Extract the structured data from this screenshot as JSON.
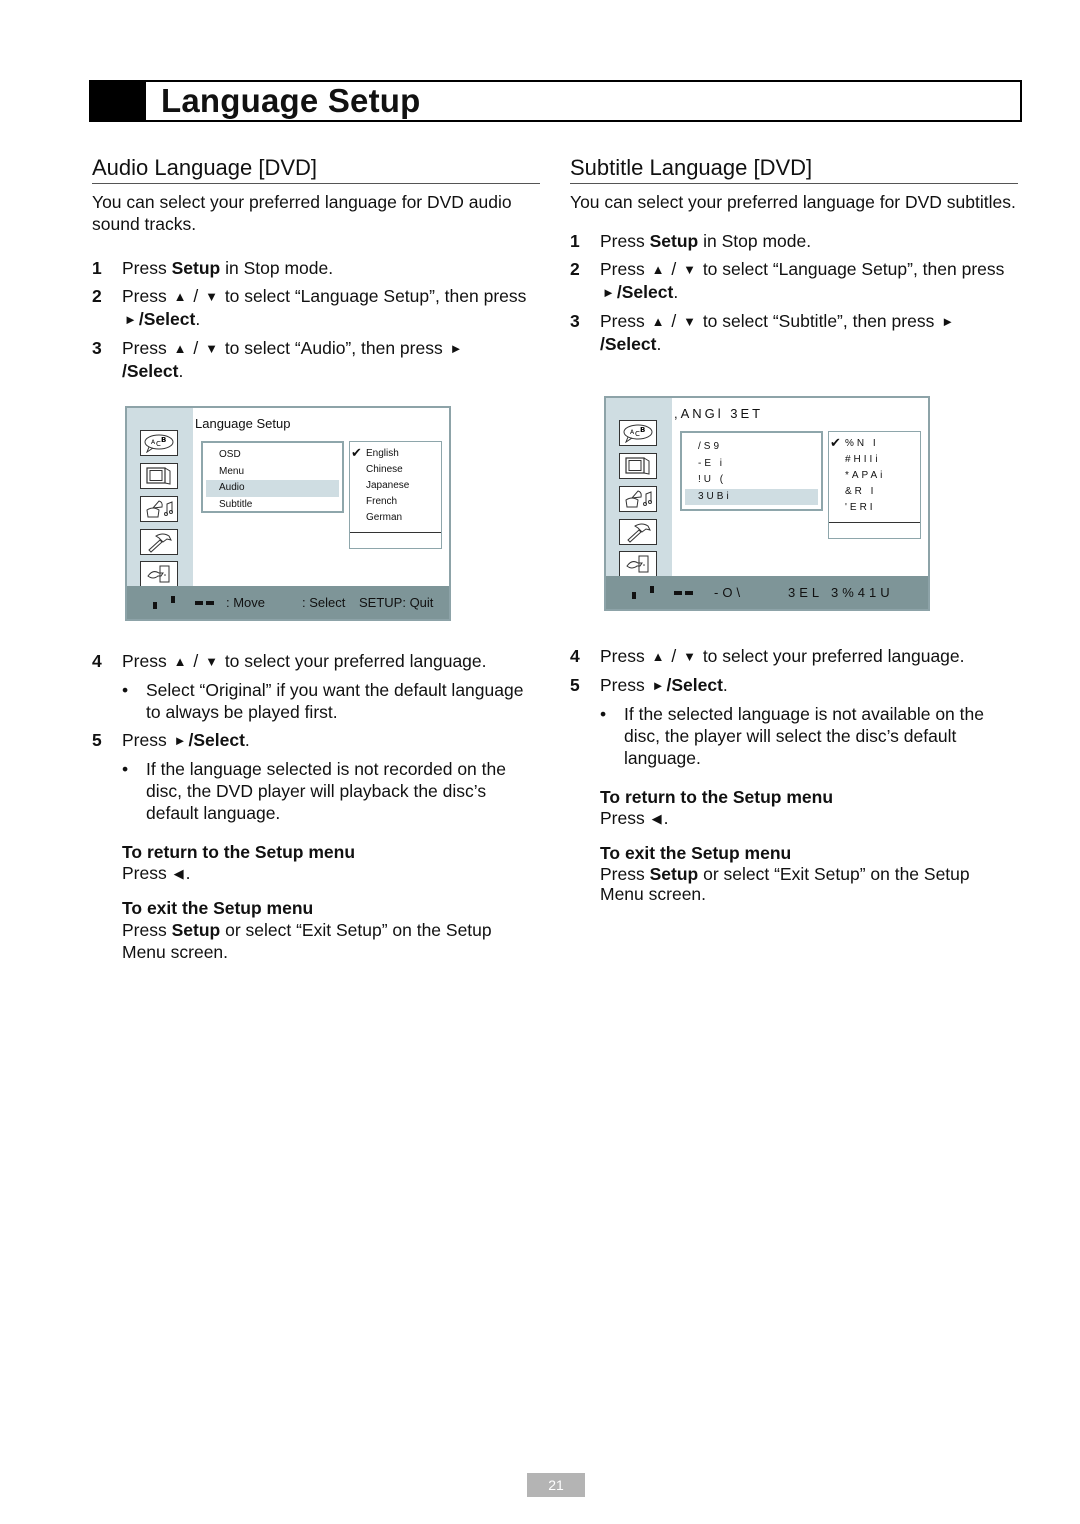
{
  "page": {
    "title": "Language Setup",
    "page_number": "21"
  },
  "audio": {
    "heading": "Audio Language [DVD]",
    "intro": "You can select your preferred language for DVD audio sound tracks.",
    "steps": [
      {
        "num": "1",
        "pre": "Press ",
        "bold": "Setup",
        "post": " in Stop mode."
      },
      {
        "num": "2",
        "pre": "Press ",
        "post": " to select “Language Setup”, then press ",
        "select": "/Select",
        "end": "."
      },
      {
        "num": "3",
        "pre": "Press ",
        "post": " to select “Audio”, then press ",
        "select": "/Select",
        "end": "."
      },
      {
        "num": "4",
        "pre": "Press ",
        "post": " to select your preferred language."
      },
      {
        "num": "5",
        "pre": "Press ",
        "select": "/Select",
        "end": "."
      }
    ],
    "bullet_4": "Select “Original” if you want the default language to always be played first.",
    "bullet_5": "If the language selected is not recorded on the disc, the DVD player will playback the disc’s default language.",
    "return_title": "To return to the Setup menu",
    "return_text": "Press",
    "exit_title": "To exit the Setup menu",
    "exit_pre": "Press ",
    "exit_bold": "Setup",
    "exit_post": " or select “Exit Setup” on the Setup Menu screen.",
    "screen": {
      "title": "Language Setup",
      "menu": [
        "OSD",
        "Menu",
        "Audio",
        "Subtitle"
      ],
      "selected_menu": "Audio",
      "options": [
        "English",
        "Chinese",
        "Japanese",
        "French",
        "German"
      ],
      "checked_option": "English",
      "footer_move": ": Move",
      "footer_select": ": Select",
      "footer_quit": "SETUP: Quit"
    }
  },
  "subtitle": {
    "heading": "Subtitle Language [DVD]",
    "intro": "You can select your preferred language for DVD subtitles.",
    "steps": [
      {
        "num": "1",
        "pre": "Press ",
        "bold": "Setup",
        "post": " in Stop mode."
      },
      {
        "num": "2",
        "pre": "Press ",
        "post": " to select “Language Setup”, then press ",
        "select": "/Select",
        "end": "."
      },
      {
        "num": "3",
        "pre": "Press ",
        "post": " to select “Subtitle”, then press ",
        "select": "/Select",
        "end": "."
      },
      {
        "num": "4",
        "pre": "Press ",
        "post": " to select your preferred language."
      },
      {
        "num": "5",
        "pre": "Press ",
        "select": "/Select",
        "end": "."
      }
    ],
    "bullet_5": "If the selected language is not available on the disc, the player will select the disc’s default language.",
    "return_title": "To return to the Setup menu",
    "return_text": "Press",
    "exit_title": "To exit the Setup menu",
    "exit_pre": "Press ",
    "exit_bold": "Setup",
    "exit_post": " or select “Exit Setup” on the Setup Menu screen.",
    "screen": {
      "title": ",ANGl 3ET",
      "menu": [
        "/S9",
        "-E i",
        "!U (",
        "3UBi"
      ],
      "selected_menu": "3UBi",
      "options": [
        "%N I",
        "#HIIi",
        "*APAi",
        "&R I",
        "'ERI"
      ],
      "checked_option": "%N I",
      "footer_move": "-O\\",
      "footer_select": "3EL",
      "footer_quit": "3%41U"
    }
  },
  "glyphs": {
    "up": "▲",
    "down": "▼",
    "right": "►",
    "left": "◀",
    "check": "✔",
    "bullet": "•",
    "slash": " / "
  }
}
